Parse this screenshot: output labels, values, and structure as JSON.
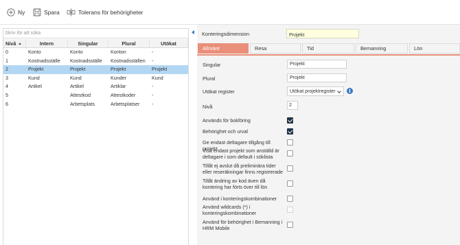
{
  "toolbar": {
    "new_label": "Ny",
    "save_label": "Spara",
    "tolerance_label": "Tolerans för behörigheter"
  },
  "list": {
    "search_placeholder": "Skriv för att söka",
    "columns": [
      "Nivå",
      "Intern",
      "Singular",
      "Plural",
      "Utökat"
    ],
    "sort_column": "Nivå",
    "rows": [
      [
        "0",
        "Konto",
        "Konto",
        "Konton",
        "-"
      ],
      [
        "1",
        "Kostnadsställe",
        "Kostnadsställe",
        "Kostnadsställen",
        "-"
      ],
      [
        "2",
        "Projekt",
        "Projekt",
        "Projekt",
        "Projekt"
      ],
      [
        "3",
        "Kund",
        "Kund",
        "Kunder",
        "Kund"
      ],
      [
        "4",
        "Artikel",
        "Artikel",
        "Artiklar",
        "-"
      ],
      [
        "5",
        "",
        "Attestkod",
        "Attestkoder",
        "-"
      ],
      [
        "6",
        "",
        "Arbetsplats",
        "Arbetsplatser",
        "-"
      ]
    ],
    "selected_index": 2
  },
  "detail": {
    "dimension_label": "Konteringsdimension",
    "dimension_value": "Projekt",
    "tabs": [
      "Allmänt",
      "Resa",
      "Tid",
      "Bemanning",
      "Lön"
    ],
    "active_tab": "Allmänt",
    "singular_label": "Singular",
    "singular_value": "Projekt",
    "plural_label": "Plural",
    "plural_value": "Projekt",
    "extended_label": "Utökat register",
    "extended_value": "Utökat projektregister",
    "level_label": "Nivå",
    "level_value": "2",
    "options": [
      {
        "label": "Används för bokföring",
        "checked": true,
        "disabled": false
      },
      {
        "label": "Behörighet och urval",
        "checked": true,
        "disabled": false
      },
      {
        "label": "Ge endast deltagare tillgång till projekt",
        "checked": false,
        "disabled": false
      },
      {
        "label": "Visa endast projekt som anställd är deltagare i som default i söklista",
        "checked": false,
        "disabled": false
      },
      {
        "label": "Tillåt ej avslut då preliminära tider eller reseräkningar finns registrerade",
        "checked": false,
        "disabled": false
      },
      {
        "label": "Tillåt ändring av kod även då kontering har förts över till lön",
        "checked": false,
        "disabled": false
      },
      {
        "label": "Använd i konteringskombinationer",
        "checked": false,
        "disabled": false
      },
      {
        "label": "Använd wildcards (*) i konteringskombinationer",
        "checked": false,
        "disabled": true
      },
      {
        "label": "Använd för behörighet i Bemanning i HRM Mobile",
        "checked": false,
        "disabled": false
      }
    ]
  },
  "colors": {
    "accent_tab": "#e98f7a",
    "selected_row": "#b3d7f3",
    "highlight_field": "#ffffe0",
    "checkbox_on": "#1f3447",
    "info_icon": "#3a78c2"
  }
}
